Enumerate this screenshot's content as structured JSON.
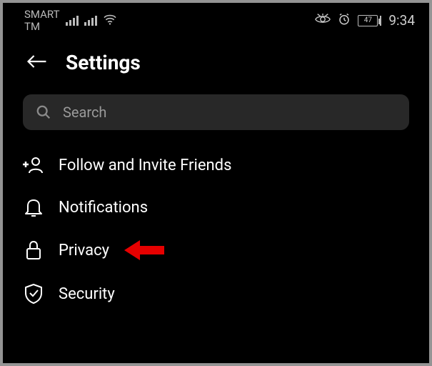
{
  "statusbar": {
    "carrier_line1": "SMART",
    "carrier_line2": "TM",
    "battery_level": "47",
    "clock": "9:34"
  },
  "header": {
    "title": "Settings"
  },
  "search": {
    "placeholder": "Search"
  },
  "menu": {
    "items": [
      {
        "label": "Follow and Invite Friends"
      },
      {
        "label": "Notifications"
      },
      {
        "label": "Privacy"
      },
      {
        "label": "Security"
      }
    ]
  }
}
